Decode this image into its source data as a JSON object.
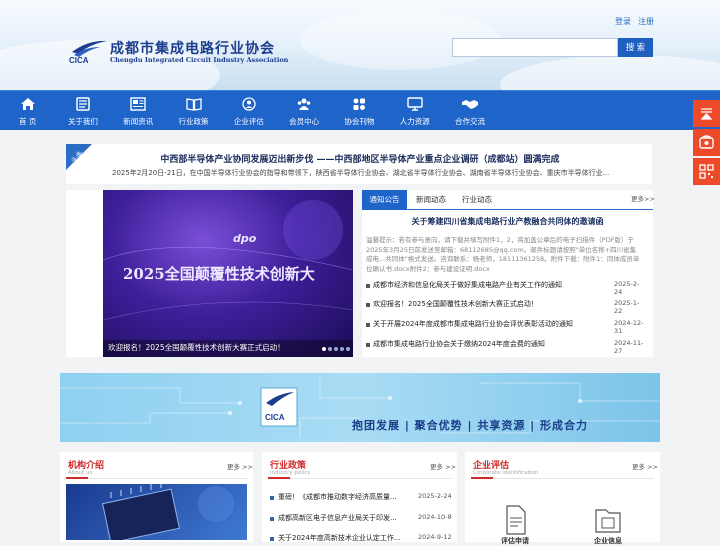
{
  "header": {
    "logo_cn": "成都市集成电路行业协会",
    "logo_en": "Chengdu Integrated Circuit Industry Association",
    "logo_abbr": "CICA",
    "login": "登录",
    "register": "注册",
    "search_placeholder": "",
    "search_button": "搜 索"
  },
  "nav": [
    {
      "label": "首 页",
      "icon": "home-icon"
    },
    {
      "label": "关于我们",
      "icon": "document-icon"
    },
    {
      "label": "新闻资讯",
      "icon": "newspaper-icon"
    },
    {
      "label": "行业政策",
      "icon": "book-icon"
    },
    {
      "label": "企业评估",
      "icon": "user-badge-icon"
    },
    {
      "label": "会员中心",
      "icon": "group-icon"
    },
    {
      "label": "协会刊物",
      "icon": "apps-icon"
    },
    {
      "label": "人力资源",
      "icon": "monitor-icon"
    },
    {
      "label": "合作交流",
      "icon": "handshake-icon"
    }
  ],
  "side_float": [
    {
      "icon": "collapse-icon"
    },
    {
      "icon": "phone-icon"
    },
    {
      "icon": "qrcode-icon"
    }
  ],
  "headline": {
    "tag": "头条",
    "title": "中西部半导体产业协同发展迈出新步伐 ——中西部地区半导体产业重点企业调研（成都站）圆满完成",
    "summary": "2025年2月20日-21日，在中国半导体行业协会的指导和带领下，陕西省半导体行业协会、湖北省半导体行业协会、湖南省半导体行业协会、重庆市半导体行业..."
  },
  "banner": {
    "title": "2025全国颠覆性技术创新大",
    "logo_text": "dpo",
    "caption": "欢迎报名！2025全国颠覆性技术创新大赛正式启动！",
    "dots": 5,
    "colors": {
      "bg": "#3d1f9a",
      "text": "#e7e0ff"
    }
  },
  "news": {
    "tabs": [
      "通知公告",
      "新闻动态",
      "行业动态"
    ],
    "active_tab": 0,
    "more": "更多>>",
    "featured_title": "关于筹建四川省集成电路行业产教融合共同体的邀请函",
    "featured_summary": "温馨提示：若有参与意向，请下载并填写附件1，2，将加盖公章后的电子扫描件（PDF版）于2025年3月25日前发送至邮箱：68112685@qq.com。邮件标题请按照\"单位名称+四川省集成电...共同体\"格式发送。咨询联系：杨老师，18111361258。附件下载：附件1：同体成员单位确认书.docx附件2：参与建设证明.docx",
    "items": [
      {
        "title": "成都市经济和信息化局关于做好集成电路产业有关工作的通知",
        "date": "2025-2-24"
      },
      {
        "title": "欢迎报名！2025全国颠覆性技术创新大赛正式启动！",
        "date": "2025-1-22"
      },
      {
        "title": "关于开展2024年度成都市集成电路行业协会评优表彰活动的通知",
        "date": "2024-12-31"
      },
      {
        "title": "成都市集成电路行业协会关于缴纳2024年度会费的通知",
        "date": "2024-11-27"
      }
    ]
  },
  "slogan_banner": {
    "logo_abbr": "CICA",
    "slogan": "抱团发展 | 聚合优势 | 共享资源 | 形成合力"
  },
  "cards": {
    "intro": {
      "title": "机构介绍",
      "subtitle": "About us",
      "more": "更多 >>"
    },
    "policy": {
      "title": "行业政策",
      "subtitle": "Industry policy",
      "more": "更多 >>",
      "items": [
        {
          "title": "重磅！《成都市推动数字经济高质量...",
          "date": "2025-2-24"
        },
        {
          "title": "成都高新区电子信息产业局关于印发...",
          "date": "2024-10-8"
        },
        {
          "title": "关于2024年度高新技术企业认定工作...",
          "date": "2024-9-12"
        }
      ]
    },
    "eval": {
      "title": "企业评估",
      "subtitle": "Corporate identification",
      "more": "更多 >>",
      "items": [
        "评估申请",
        "企业信息"
      ]
    }
  }
}
